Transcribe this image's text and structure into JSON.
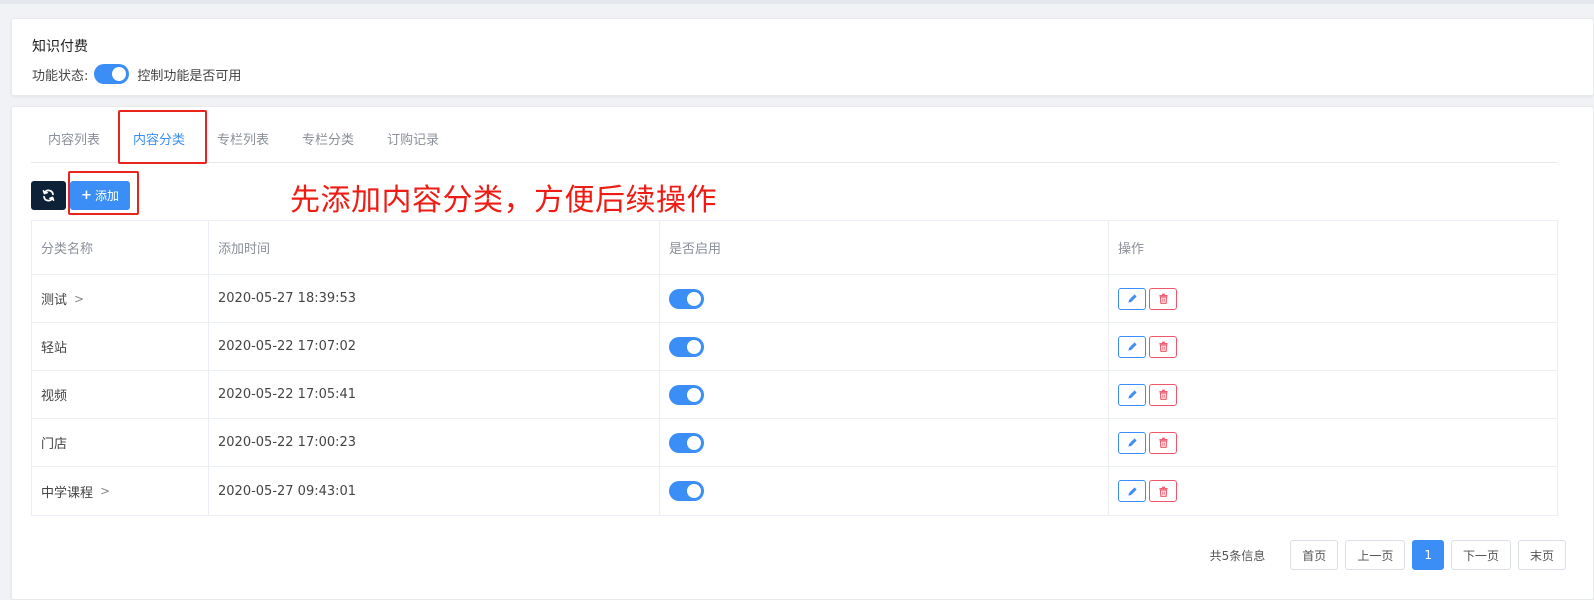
{
  "feature": {
    "title": "知识付费",
    "status_label": "功能状态:",
    "status_hint": "控制功能是否可用"
  },
  "tabs": [
    {
      "label": "内容列表"
    },
    {
      "label": "内容分类"
    },
    {
      "label": "专栏列表"
    },
    {
      "label": "专栏分类"
    },
    {
      "label": "订购记录"
    }
  ],
  "active_tab_index": 1,
  "toolbar": {
    "add_label": "添加"
  },
  "annotation": {
    "text": "先添加内容分类，方便后续操作",
    "color": "#ee1c14"
  },
  "table": {
    "headers": [
      "分类名称",
      "添加时间",
      "是否启用",
      "操作"
    ],
    "rows": [
      {
        "name": "测试",
        "time": "2020-05-27 18:39:53",
        "enabled": true,
        "has_children": true
      },
      {
        "name": "轻站",
        "time": "2020-05-22 17:07:02",
        "enabled": true,
        "has_children": false
      },
      {
        "name": "视频",
        "time": "2020-05-22 17:05:41",
        "enabled": true,
        "has_children": false
      },
      {
        "name": "门店",
        "time": "2020-05-22 17:00:23",
        "enabled": true,
        "has_children": false
      },
      {
        "name": "中学课程",
        "time": "2020-05-27 09:43:01",
        "enabled": true,
        "has_children": true
      }
    ]
  },
  "pagination": {
    "total_text": "共5条信息",
    "first": "首页",
    "prev": "上一页",
    "current": "1",
    "next": "下一页",
    "last": "末页"
  },
  "colors": {
    "accent": "#3a8ef6",
    "danger": "#f0566a",
    "dark_button": "#0d2137"
  },
  "icons": {
    "refresh": "refresh-icon",
    "add": "plus-icon",
    "edit": "pencil-icon",
    "delete": "trash-icon",
    "expand": "chevron-right-icon"
  }
}
